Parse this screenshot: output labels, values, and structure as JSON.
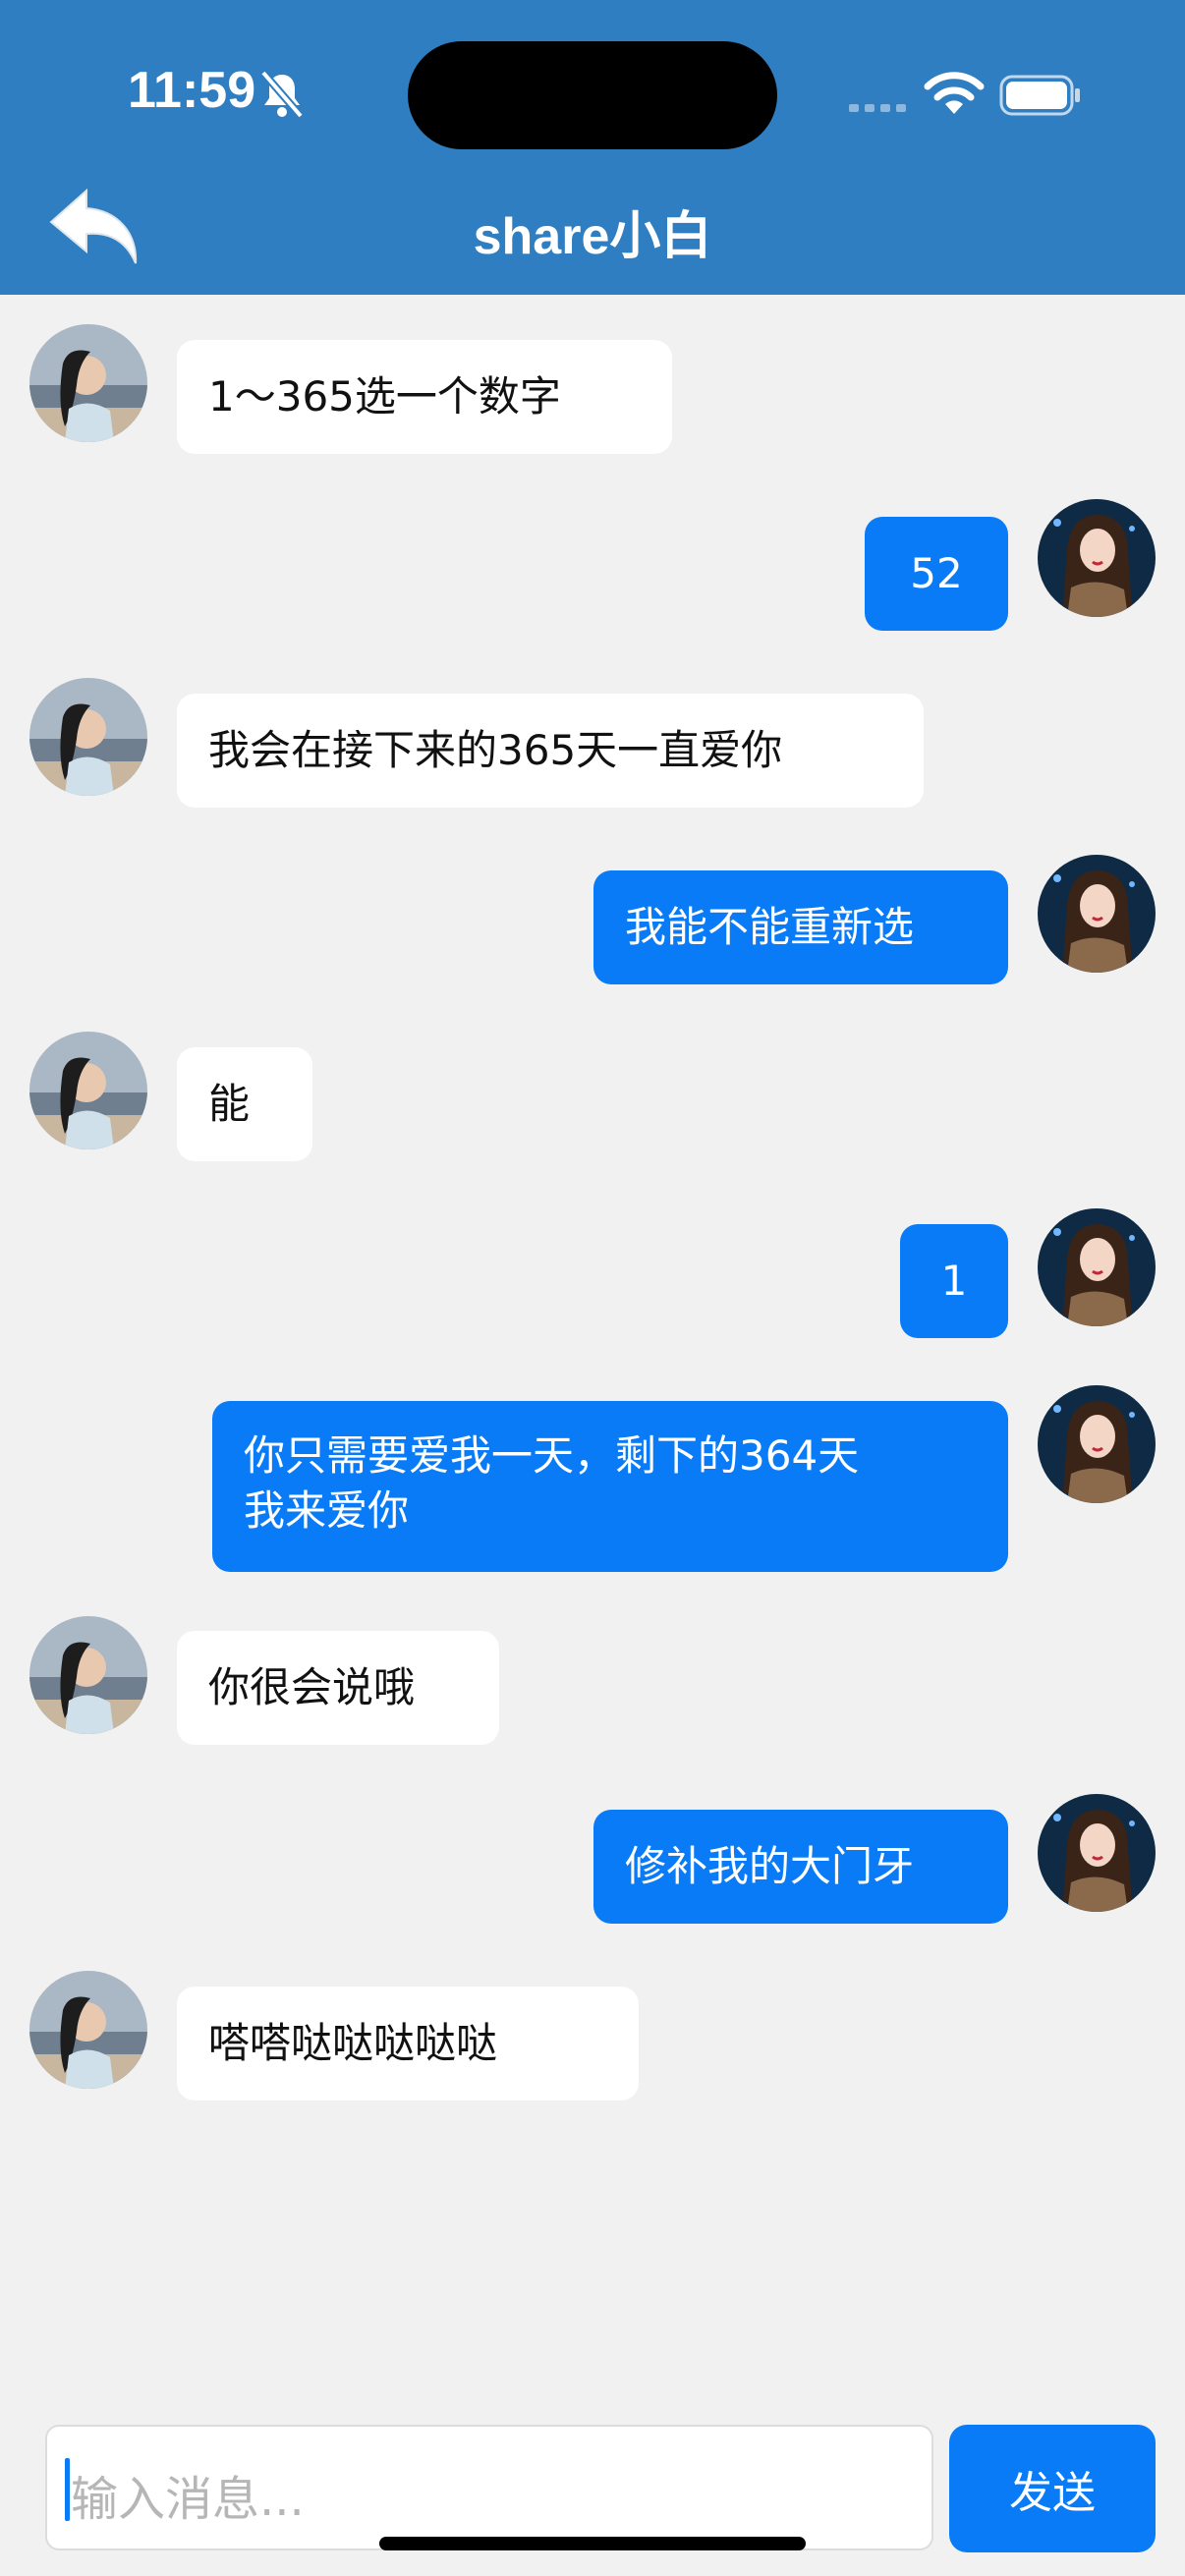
{
  "status_bar": {
    "time": "11:59"
  },
  "header": {
    "title": "share小白"
  },
  "messages": [
    {
      "side": "in",
      "text": "1～365选一个数字"
    },
    {
      "side": "out",
      "text": "52"
    },
    {
      "side": "in",
      "text": "我会在接下来的365天一直爱你"
    },
    {
      "side": "out",
      "text": "我能不能重新选"
    },
    {
      "side": "in",
      "text": "能"
    },
    {
      "side": "out",
      "text": "1"
    },
    {
      "side": "out",
      "text_line1": "你只需要爱我一天，剩下的364天",
      "text_line2": "我来爱你"
    },
    {
      "side": "in",
      "text": "你很会说哦"
    },
    {
      "side": "out",
      "text": "修补我的大门牙"
    },
    {
      "side": "in",
      "text": "嗒嗒哒哒哒哒哒"
    }
  ],
  "composer": {
    "placeholder": "输入消息...",
    "send_label": "发送"
  },
  "colors": {
    "header": "#2f7ec1",
    "outgoing_bubble": "#0a7bf7",
    "incoming_bubble": "#ffffff",
    "background": "#f1f1f1"
  }
}
